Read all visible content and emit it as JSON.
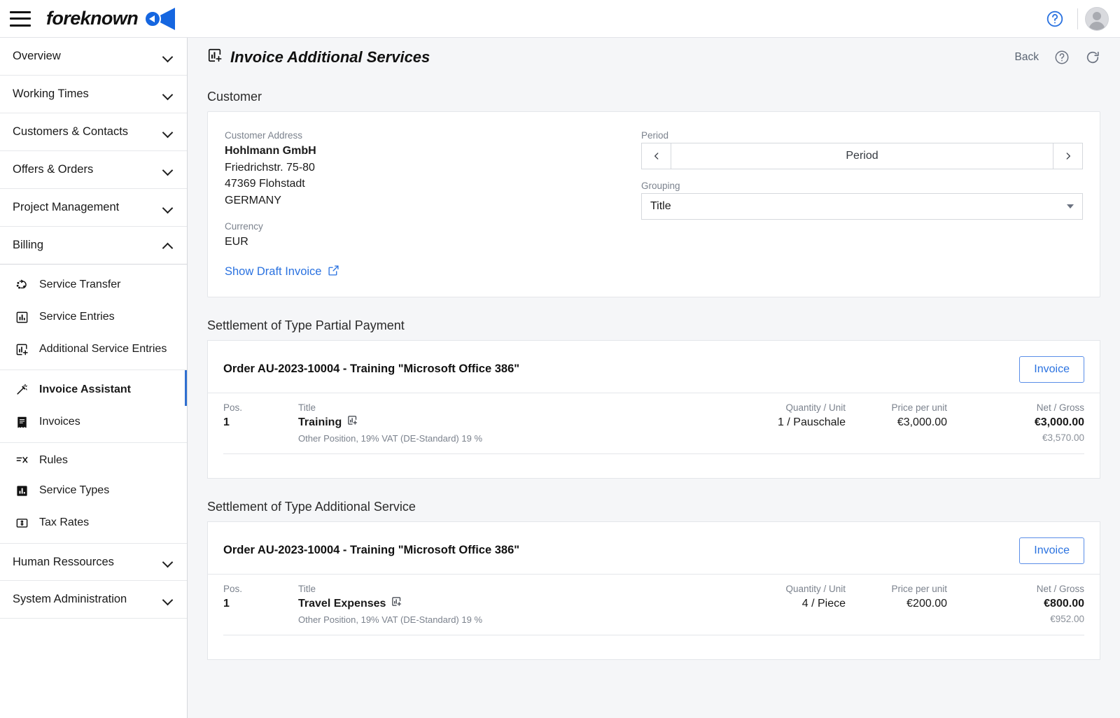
{
  "app": {
    "brand": "foreknown",
    "menu_icon": "hamburger-icon",
    "help_icon": "help-circle-icon",
    "avatar_icon": "user-avatar"
  },
  "sidebar": {
    "groups": [
      {
        "label": "Overview",
        "state": "collapsed"
      },
      {
        "label": "Working Times",
        "state": "collapsed"
      },
      {
        "label": "Customers & Contacts",
        "state": "collapsed"
      },
      {
        "label": "Offers & Orders",
        "state": "collapsed"
      },
      {
        "label": "Project Management",
        "state": "collapsed"
      },
      {
        "label": "Billing",
        "state": "expanded"
      }
    ],
    "billing_items": [
      {
        "label": "Service Transfer",
        "icon": "transfer-icon",
        "active": false
      },
      {
        "label": "Service Entries",
        "icon": "bar-chart-icon",
        "active": false
      },
      {
        "label": "Additional Service Entries",
        "icon": "bar-chart-plus-icon",
        "active": false
      },
      {
        "label": "Invoice Assistant",
        "icon": "magic-wand-icon",
        "active": true
      },
      {
        "label": "Invoices",
        "icon": "receipt-icon",
        "active": false
      },
      {
        "label": "Rules",
        "icon": "rules-icon",
        "active": false
      },
      {
        "label": "Service Types",
        "icon": "bar-chart-filled-icon",
        "active": false
      },
      {
        "label": "Tax Rates",
        "icon": "money-icon",
        "active": false
      }
    ],
    "bottom_groups": [
      {
        "label": "Human Ressources",
        "state": "collapsed"
      },
      {
        "label": "System Administration",
        "state": "collapsed"
      }
    ]
  },
  "header": {
    "title": "Invoice Additional Services",
    "title_icon": "bar-chart-plus-icon",
    "back_label": "Back",
    "help_icon": "help-circle-icon",
    "refresh_icon": "refresh-icon"
  },
  "customer_section": {
    "label": "Customer",
    "address_label": "Customer Address",
    "company": "Hohlmann GmbH",
    "street": "Friedrichstr. 75-80",
    "city": "47369 Flohstadt",
    "country": "GERMANY",
    "currency_label": "Currency",
    "currency": "EUR",
    "draft_link": "Show Draft Invoice",
    "draft_link_icon": "external-link-icon",
    "period_label": "Period",
    "period_value": "Period",
    "period_prev_icon": "chevron-left-icon",
    "period_next_icon": "chevron-right-icon",
    "grouping_label": "Grouping",
    "grouping_value": "Title"
  },
  "table_headers": {
    "pos": "Pos.",
    "title": "Title",
    "quantity": "Quantity / Unit",
    "price": "Price per unit",
    "net_gross": "Net / Gross"
  },
  "settlements": [
    {
      "section_label": "Settlement of Type Partial Payment",
      "order_title": "Order AU-2023-10004 - Training \"Microsoft Office 386\"",
      "invoice_button": "Invoice",
      "rows": [
        {
          "pos": "1",
          "title": "Training",
          "title_icon": "bar-chart-plus-icon",
          "subtitle": "Other Position, 19% VAT (DE-Standard) 19 %",
          "quantity": "1 / Pauschale",
          "price": "€3,000.00",
          "net": "€3,000.00",
          "gross": "€3,570.00"
        }
      ]
    },
    {
      "section_label": "Settlement of Type Additional Service",
      "order_title": "Order AU-2023-10004 - Training \"Microsoft Office 386\"",
      "invoice_button": "Invoice",
      "rows": [
        {
          "pos": "1",
          "title": "Travel Expenses",
          "title_icon": "bar-chart-plus-icon",
          "subtitle": "Other Position, 19% VAT (DE-Standard) 19 %",
          "quantity": "4 / Piece",
          "price": "€200.00",
          "net": "€800.00",
          "gross": "€952.00"
        }
      ]
    }
  ],
  "colors": {
    "accent_blue": "#2a72e0",
    "logo_blue": "#1566e0",
    "muted_text": "#7b828d",
    "page_bg": "#f5f6f8"
  }
}
